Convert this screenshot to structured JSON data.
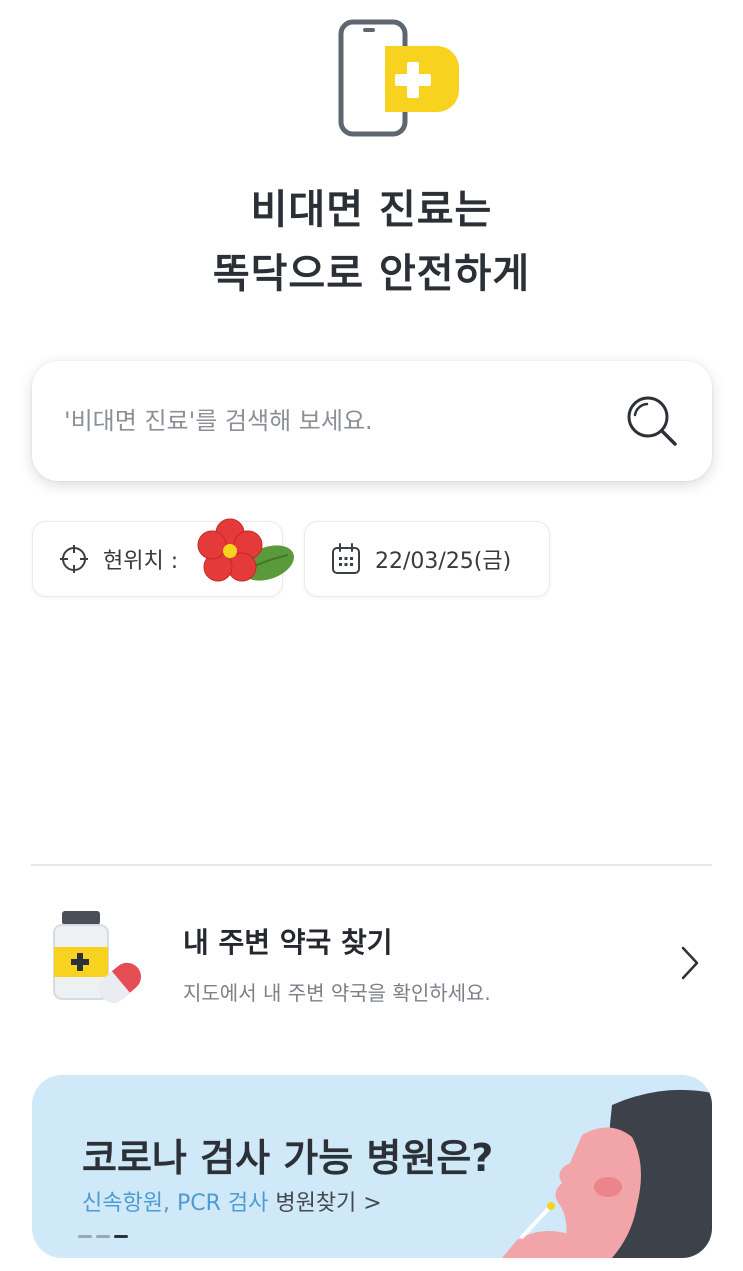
{
  "hero": {
    "line1": "비대면 진료는",
    "line2": "똑닥으로 안전하게"
  },
  "search": {
    "placeholder": "'비대면 진료'를 검색해 보세요."
  },
  "chips": {
    "location_label": "현위치 :",
    "date_label": "22/03/25(금)"
  },
  "pharmacy": {
    "title": "내 주변 약국 찾기",
    "subtitle": "지도에서 내 주변 약국을 확인하세요."
  },
  "banner": {
    "title": "코로나 검사 가능 병원은?",
    "sub_highlight": "신속항원, PCR 검사",
    "sub_rest": " 병원찾기 >",
    "slides_total": 3,
    "slide_active": 3
  },
  "colors": {
    "brand_yellow": "#f7d21f",
    "banner_bg": "#cfe9f8",
    "highlight_blue": "#4d9bd1"
  }
}
